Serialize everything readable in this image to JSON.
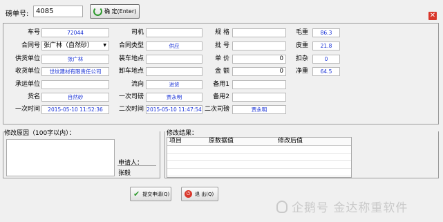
{
  "top": {
    "ticket_label": "磅单号:",
    "ticket_value": "4085",
    "confirm_label": "确 定(Enter)"
  },
  "fields": {
    "vehicle_no_label": "车号",
    "vehicle_no": "72044",
    "contract_no_label": "合同号",
    "contract_no": "张广林（自然砂）",
    "supplier_label": "供货单位",
    "supplier": "张广林",
    "receiver_label": "收货单位",
    "receiver": "世纹建材有限责任公司",
    "carrier_label": "承运单位",
    "carrier": "",
    "goods_label": "货名",
    "goods": "自然砂",
    "first_time_label": "一次时间",
    "first_time": "2015-05-10 11:52:36",
    "driver_label": "司机",
    "driver": "",
    "contract_type_label": "合同类型",
    "contract_type": "供应",
    "load_place_label": "装车地点",
    "load_place": "",
    "unload_place_label": "卸车地点",
    "unload_place": "",
    "direction_label": "流向",
    "direction": "进货",
    "first_weigher_label": "一次司磅",
    "first_weigher": "贾永明",
    "second_time_label": "二次时间",
    "second_time": "2015-05-10 11:47:54",
    "spec_label": "规 格",
    "spec": "",
    "batch_label": "批 号",
    "batch": "",
    "unit_price_label": "单 价",
    "unit_price": "0",
    "amount_label": "金 额",
    "amount": "0",
    "remark1_label": "备用1",
    "remark1": "",
    "remark2_label": "备用2",
    "remark2": "",
    "second_weigher_label": "二次司磅",
    "second_weigher": "贾永明",
    "gross_label": "毛重",
    "gross": "86.3",
    "tare_label": "皮重",
    "tare": "21.8",
    "deduct_label": "扣杂",
    "deduct": "0",
    "net_label": "净重",
    "net": "64.5"
  },
  "reason": {
    "title": "修改原因（100字以内）：",
    "applicant_label": "申请人：",
    "applicant": "张毅"
  },
  "result": {
    "title": "修改结果：",
    "columns": [
      "项目",
      "原数据值",
      "修改后值"
    ]
  },
  "actions": {
    "submit_label": "提交申请(Q)",
    "exit_label": "退 出(Q)"
  },
  "watermark": "企鹅号 金达称重软件",
  "colors": {
    "field_text": "#1a33d6",
    "close_red": "#d9372b",
    "ok_green": "#2e9a2e"
  }
}
